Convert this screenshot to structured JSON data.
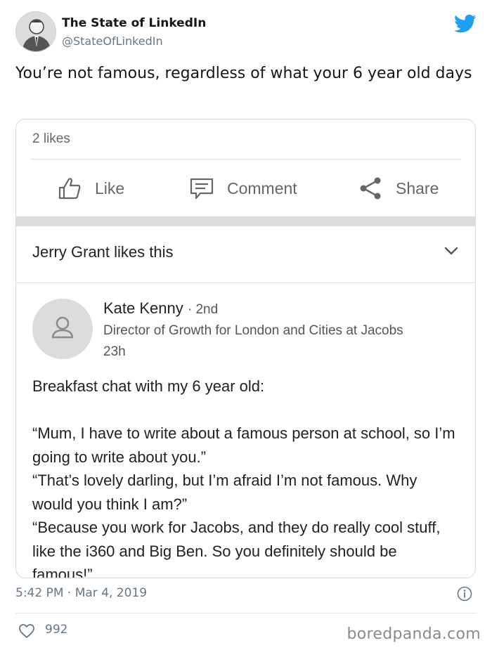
{
  "tweet": {
    "author_name": "The State of LinkedIn",
    "author_handle": "@StateOfLinkedIn",
    "text": "You’re not famous, regardless of what your 6 year old days",
    "timestamp": "5:42 PM · Mar 4, 2019",
    "likes": "992"
  },
  "embed": {
    "likes_count": "2 likes",
    "actions": [
      {
        "label": "Like",
        "icon": "thumbs-up-icon"
      },
      {
        "label": "Comment",
        "icon": "comment-icon"
      },
      {
        "label": "Share",
        "icon": "share-icon"
      }
    ],
    "social_action": "Jerry Grant likes this",
    "poster": {
      "name": "Kate Kenny",
      "degree": "· 2nd",
      "title": "Director of Growth for London and Cities at Jacobs",
      "time": "23h"
    },
    "post_lines": [
      "Breakfast chat with my 6 year old:",
      "",
      "“Mum, I have to write about a famous person at school, so I’m going to write about you.”",
      "“That’s lovely darling, but I’m afraid I’m not famous. Why would you think I am?”",
      "“Because you work for Jacobs, and they do really cool stuff, like the i360 and Big Ben. So you definitely should be famous!”"
    ]
  },
  "watermark": "boredpanda.com",
  "colors": {
    "twitter_blue": "#1da1f2",
    "secondary_text": "#657786",
    "linkedin_gray": "#666666"
  }
}
